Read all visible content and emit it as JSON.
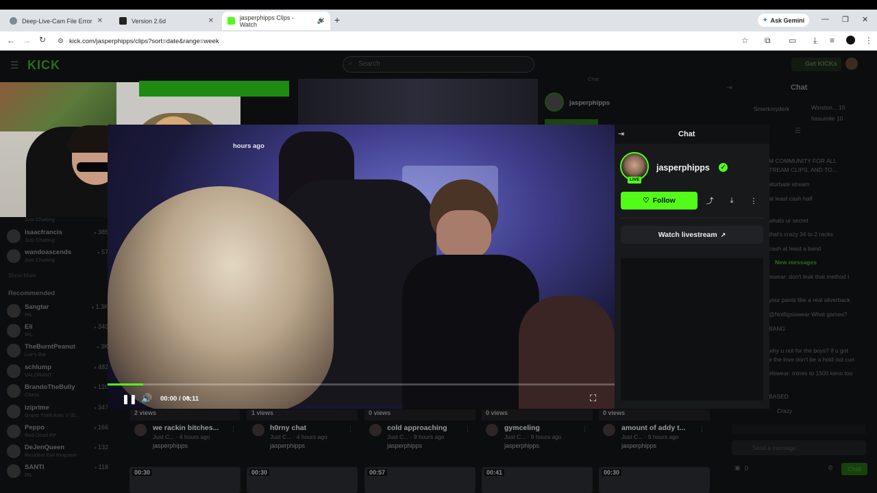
{
  "browser": {
    "tabs": [
      {
        "title": "Deep-Live-Cam File Error",
        "fav_color": "#7a8a99"
      },
      {
        "title": "Version 2.6d",
        "fav_color": "#222222"
      },
      {
        "title": "jasperphipps Clips - Watch",
        "fav_color": "#53fc18"
      }
    ],
    "new_tab": "+",
    "ask_gemini": "Ask Gemini",
    "url": "kick.com/jasperphipps/clips?sort=date&range=week"
  },
  "site": {
    "logo": "KICK",
    "search_placeholder": "Search",
    "get_kicks": "Get KICKs"
  },
  "sidebar": {
    "following": [
      {
        "name": "isaacfrancis",
        "category": "Just Chatting",
        "viewers": "385"
      },
      {
        "name": "wandoascends",
        "category": "Just Chatting",
        "viewers": "57"
      }
    ],
    "partial_category": "Just Chatting",
    "show_more": "Show More",
    "recommended_label": "Recommended",
    "recommended": [
      {
        "name": "Sangtar",
        "category": "IRL",
        "viewers": "1.3K"
      },
      {
        "name": "Eli",
        "category": "IRL",
        "viewers": "340"
      },
      {
        "name": "TheBurntPeanut",
        "category": "Liar's Bar",
        "viewers": "3K"
      },
      {
        "name": "schlump",
        "category": "VALORANT",
        "viewers": "482"
      },
      {
        "name": "BrandoTheBully",
        "category": "Chess",
        "viewers": "120"
      },
      {
        "name": "iziprime",
        "category": "Grand Theft Auto V (G...",
        "viewers": "347"
      },
      {
        "name": "Peppo",
        "category": "Red Dead RP",
        "viewers": "166"
      },
      {
        "name": "DeJenQueen",
        "category": "Resident Evil Requiem",
        "viewers": "132"
      },
      {
        "name": "SANTI",
        "category": "IRL",
        "viewers": "118"
      }
    ]
  },
  "video": {
    "time_ago": "hours ago",
    "current_time": "00:00",
    "duration": "00:11",
    "progress": 0.07
  },
  "chat_panel": {
    "title": "Chat",
    "username": "jasperphipps",
    "live_badge": "LIVE",
    "follow_label": "Follow",
    "watch_livestream": "Watch livestream"
  },
  "clips": [
    {
      "views": "2 views",
      "title": "we rackin bitches...",
      "sub": "Just C... · 4 hours ago",
      "user": "jasperphipps",
      "duration": "00:30"
    },
    {
      "views": "1 views",
      "title": "h0rny chat",
      "sub": "Just C... · 4 hours ago",
      "user": "jasperphipps",
      "duration": "00:30"
    },
    {
      "views": "0 views",
      "title": "cold approaching",
      "sub": "Just C... · 9 hours ago",
      "user": "jasperphipps",
      "duration": "00:57"
    },
    {
      "views": "0 views",
      "title": "gymceling",
      "sub": "Just C... · 9 hours ago",
      "user": "jasperphipps",
      "duration": "00:41"
    },
    {
      "views": "0 views",
      "title": "amount of addy t...",
      "sub": "Just C... · 9 hours ago",
      "user": "jasperphipps",
      "duration": "00:30"
    }
  ],
  "background": {
    "bg_streamer": "jasperphipps",
    "bg_chat_label": "Chat",
    "chat_title": "Chat",
    "chat_lines": [
      "Smerkmyderk",
      "Winston... 15",
      "hasumite 10",
      "M COMMUNITY FOR ALL",
      "TREAM CLIPS, AND TO...",
      "aturbate stream",
      "at least cash half",
      "whats ur secret",
      "that's crazy 34 to 2 racks",
      "cash at least a band",
      "iswear: don't leak that method I",
      "your pants like a real silverback",
      "@Notfigsiswear What games?",
      "BANG",
      "why u not for the boys? if u got",
      "e the love don't be a hold out cun",
      "elswear: mines to 1500 keno too",
      "BASED",
      "Crazy"
    ],
    "new_messages": "New messages",
    "send_placeholder": "Send a message",
    "chat_button": "Chat",
    "points": "0"
  }
}
